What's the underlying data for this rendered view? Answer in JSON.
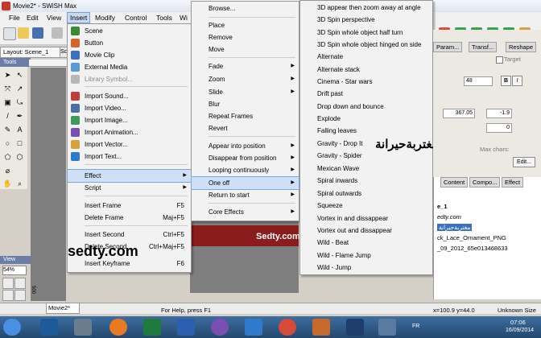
{
  "window": {
    "title": "Movie2* - SWiSH Max"
  },
  "menubar": {
    "items": [
      "File",
      "Edit",
      "View",
      "Insert",
      "Modify",
      "Control",
      "Tools",
      "Wi"
    ]
  },
  "layout_tab": "Layout: Scene_1",
  "layout_tab2": "Sc",
  "tools_label": "Tools",
  "view_label": "View",
  "zoom_value": "54%",
  "ruler_mark": "500",
  "insert_menu": {
    "items": [
      {
        "label": "Scene",
        "icon": "scene-icon"
      },
      {
        "label": "Button",
        "icon": "button-icon"
      },
      {
        "label": "Movie Clip",
        "icon": "movieclip-icon"
      },
      {
        "label": "External Media",
        "icon": "external-media-icon"
      },
      {
        "label": "Library Symbol...",
        "icon": "library-icon",
        "disabled": true
      },
      {
        "label": "Import Sound...",
        "icon": "import-sound-icon"
      },
      {
        "label": "Import Video...",
        "icon": "import-video-icon"
      },
      {
        "label": "Import Image...",
        "icon": "import-image-icon"
      },
      {
        "label": "Import Animation...",
        "icon": "import-animation-icon"
      },
      {
        "label": "Import Vector...",
        "icon": "import-vector-icon"
      },
      {
        "label": "Import Text...",
        "icon": "import-text-icon"
      },
      {
        "label": "Effect",
        "submenu": true
      },
      {
        "label": "Script",
        "submenu": true
      },
      {
        "label": "Insert Frame",
        "shortcut": "F5"
      },
      {
        "label": "Delete Frame",
        "shortcut": "Maj+F5"
      },
      {
        "label": "Insert Second",
        "shortcut": "Ctrl+F5"
      },
      {
        "label": "Delete Second",
        "shortcut": "Ctrl+Maj+F5"
      },
      {
        "label": "Insert Keyframe",
        "shortcut": "F6"
      }
    ]
  },
  "effect_menu": {
    "items": [
      "Browse...",
      "Place",
      "Remove",
      "Move",
      "Fade",
      "Zoom",
      "Slide",
      "Blur",
      "Repeat Frames",
      "Revert",
      "Appear into position",
      "Disappear from position",
      "Looping continuously",
      "One off",
      "Return to start",
      "Core Effects"
    ]
  },
  "oneoff_menu": {
    "items": [
      "3D appear then zoom away at angle",
      "3D Spin perspective",
      "3D Spin whole object half turn",
      "3D Spin whole object hinged on side",
      "Alternate",
      "Alternate stack",
      "Cinema - Star wars",
      "Drift past",
      "Drop down and bounce",
      "Explode",
      "Falling leaves",
      "Gravity - Drop It",
      "Gravity - Spider",
      "Mexican Wave",
      "Spiral inwards",
      "Spiral outwards",
      "Squeeze",
      "Vortex in and dissappear",
      "Vortex out and dissappear",
      "Wild - Beat",
      "Wild - Flame Jump",
      "Wild - Jump"
    ]
  },
  "watermarks": {
    "arabic": "مغتربةحيرانة",
    "sedty1": "sedty.com",
    "sedty2": "Sedty.com"
  },
  "right_panel": {
    "tabs": [
      "Param...",
      "Transf...",
      "Reshape"
    ],
    "target_label": "Target",
    "font_size": "48",
    "bold": "B",
    "italic": "I",
    "value1": "367.05",
    "value2": "-1.9",
    "value3": "0",
    "max_chars_label": "Max chars:",
    "edit_button": "Edit..."
  },
  "outline_panel": {
    "tabs": [
      "Content",
      "Compo...",
      "Effect"
    ],
    "rows": [
      "e_1",
      "edty.com",
      "مغتربةحيرانة",
      "ck_Lace_Ornament_PNG",
      "_09_2012_65e013468633"
    ]
  },
  "document_tab": "Movie2*",
  "status": {
    "help": "For Help, press F1",
    "coords": "x=100.9 y=44.0",
    "size": "Unknown Size"
  },
  "taskbar": {
    "lang": "FR",
    "time": "07:06",
    "date": "16/09/2014"
  },
  "colors": {
    "menu_highlight": "#cfe0f6",
    "title_blue": "#6b7ea6",
    "taskbar": "#2f5a86"
  }
}
